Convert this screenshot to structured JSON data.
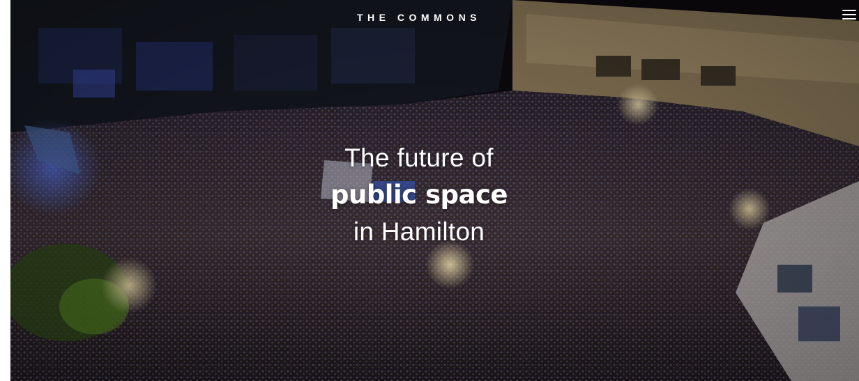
{
  "header": {
    "brand": "THE COMMONS",
    "menu_icon": "hamburger-menu-icon"
  },
  "hero": {
    "line1": "The future of",
    "line2": "public space",
    "line3": "in Hamilton",
    "background_image": "aerial night crowd in public square"
  },
  "colors": {
    "text": "#ffffff",
    "background": "#0a0608"
  }
}
